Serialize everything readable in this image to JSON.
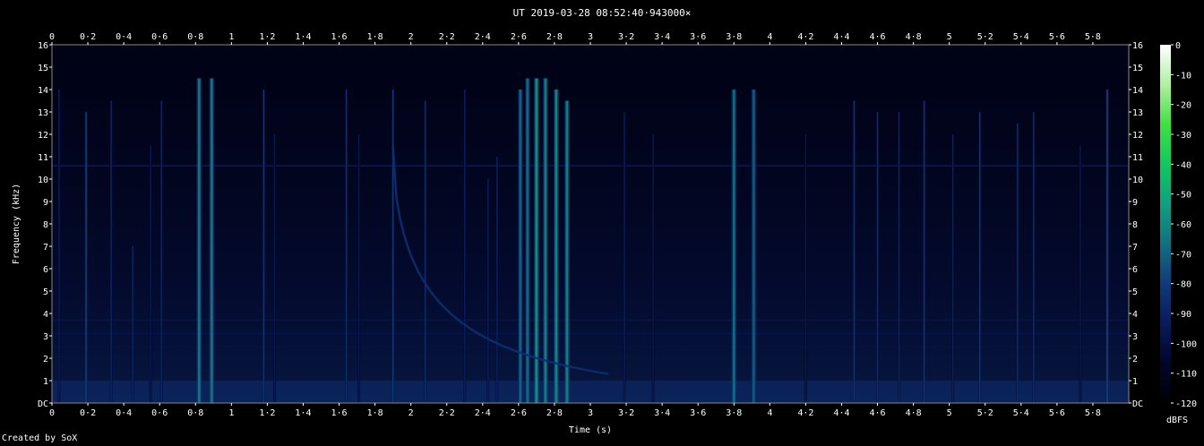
{
  "title": "UT 2019-03-28 08:52:40·943000×",
  "credit": "Created by SoX",
  "chart_data": {
    "type": "heatmap",
    "title": "UT 2019-03-28 08:52:40·943000×",
    "xlabel": "Time (s)",
    "ylabel": "Frequency (kHz)",
    "xlim": [
      0,
      6.0
    ],
    "ylim": [
      0,
      16
    ],
    "x_ticks": [
      "0",
      "0·2",
      "0·4",
      "0·6",
      "0·8",
      "1",
      "1·2",
      "1·4",
      "1·6",
      "1·8",
      "2",
      "2·2",
      "2·4",
      "2·6",
      "2·8",
      "3",
      "3·2",
      "3·4",
      "3·6",
      "3·8",
      "4",
      "4·2",
      "4·4",
      "4·6",
      "4·8",
      "5",
      "5·2",
      "5·4",
      "5·6",
      "5·8"
    ],
    "x_tick_values": [
      0,
      0.2,
      0.4,
      0.6,
      0.8,
      1.0,
      1.2,
      1.4,
      1.6,
      1.8,
      2.0,
      2.2,
      2.4,
      2.6,
      2.8,
      3.0,
      3.2,
      3.4,
      3.6,
      3.8,
      4.0,
      4.2,
      4.4,
      4.6,
      4.8,
      5.0,
      5.2,
      5.4,
      5.6,
      5.8
    ],
    "y_ticks": [
      "DC",
      "1",
      "2",
      "3",
      "4",
      "5",
      "6",
      "7",
      "8",
      "9",
      "10",
      "11",
      "12",
      "13",
      "14",
      "15",
      "16"
    ],
    "y_tick_values": [
      0,
      1,
      2,
      3,
      4,
      5,
      6,
      7,
      8,
      9,
      10,
      11,
      12,
      13,
      14,
      15,
      16
    ],
    "colorbar": {
      "label": "dBFS",
      "ticks": [
        "0",
        "-10",
        "-20",
        "-30",
        "-40",
        "-50",
        "-60",
        "-70",
        "-80",
        "-90",
        "-100",
        "-110",
        "-120"
      ],
      "tick_values": [
        0,
        -10,
        -20,
        -30,
        -40,
        -50,
        -60,
        -70,
        -80,
        -90,
        -100,
        -110,
        -120
      ],
      "range": [
        -120,
        0
      ],
      "colors": [
        "#000005",
        "#00062a",
        "#0a1a5a",
        "#103a7a",
        "#127080",
        "#10a080",
        "#10c860",
        "#40e040",
        "#b0f0a0",
        "#ffffff"
      ]
    },
    "background_level_db": -108,
    "low_band": {
      "fmax_khz": 1.0,
      "level_db": -85
    },
    "hum_lines": [
      {
        "freq_khz": 10.6,
        "level_db": -92
      },
      {
        "freq_khz": 3.7,
        "level_db": -96
      },
      {
        "freq_khz": 3.1,
        "level_db": -96
      },
      {
        "freq_khz": 2.5,
        "level_db": -98
      }
    ],
    "chirp": {
      "t_start": 1.9,
      "t_end": 3.1,
      "f_start_khz": 11.5,
      "f_end_khz": 1.3,
      "level_db": -85
    },
    "clicks": [
      {
        "t": 0.04,
        "fmax_khz": 14.0,
        "level_db": -92
      },
      {
        "t": 0.19,
        "fmax_khz": 13.0,
        "level_db": -78
      },
      {
        "t": 0.33,
        "fmax_khz": 13.5,
        "level_db": -88
      },
      {
        "t": 0.45,
        "fmax_khz": 7.0,
        "level_db": -88
      },
      {
        "t": 0.55,
        "fmax_khz": 11.5,
        "level_db": -95
      },
      {
        "t": 0.61,
        "fmax_khz": 13.5,
        "level_db": -88
      },
      {
        "t": 0.82,
        "fmax_khz": 14.5,
        "level_db": -65
      },
      {
        "t": 0.89,
        "fmax_khz": 14.5,
        "level_db": -65
      },
      {
        "t": 1.18,
        "fmax_khz": 14.0,
        "level_db": -82
      },
      {
        "t": 1.24,
        "fmax_khz": 12.0,
        "level_db": -95
      },
      {
        "t": 1.64,
        "fmax_khz": 14.0,
        "level_db": -85
      },
      {
        "t": 1.71,
        "fmax_khz": 12.0,
        "level_db": -95
      },
      {
        "t": 1.9,
        "fmax_khz": 14.0,
        "level_db": -80
      },
      {
        "t": 2.08,
        "fmax_khz": 13.5,
        "level_db": -85
      },
      {
        "t": 2.3,
        "fmax_khz": 14.0,
        "level_db": -92
      },
      {
        "t": 2.43,
        "fmax_khz": 10.0,
        "level_db": -92
      },
      {
        "t": 2.48,
        "fmax_khz": 11.0,
        "level_db": -90
      },
      {
        "t": 2.61,
        "fmax_khz": 14.0,
        "level_db": -70
      },
      {
        "t": 2.65,
        "fmax_khz": 14.5,
        "level_db": -68
      },
      {
        "t": 2.7,
        "fmax_khz": 14.5,
        "level_db": -58
      },
      {
        "t": 2.75,
        "fmax_khz": 14.5,
        "level_db": -62
      },
      {
        "t": 2.81,
        "fmax_khz": 14.0,
        "level_db": -60
      },
      {
        "t": 2.87,
        "fmax_khz": 13.5,
        "level_db": -62
      },
      {
        "t": 3.19,
        "fmax_khz": 13.0,
        "level_db": -92
      },
      {
        "t": 3.35,
        "fmax_khz": 12.0,
        "level_db": -95
      },
      {
        "t": 3.8,
        "fmax_khz": 14.0,
        "level_db": -68
      },
      {
        "t": 3.91,
        "fmax_khz": 14.0,
        "level_db": -72
      },
      {
        "t": 4.2,
        "fmax_khz": 12.0,
        "level_db": -95
      },
      {
        "t": 4.47,
        "fmax_khz": 13.5,
        "level_db": -82
      },
      {
        "t": 4.6,
        "fmax_khz": 13.0,
        "level_db": -85
      },
      {
        "t": 4.72,
        "fmax_khz": 13.0,
        "level_db": -88
      },
      {
        "t": 4.86,
        "fmax_khz": 13.5,
        "level_db": -82
      },
      {
        "t": 5.02,
        "fmax_khz": 12.0,
        "level_db": -90
      },
      {
        "t": 5.17,
        "fmax_khz": 13.0,
        "level_db": -82
      },
      {
        "t": 5.38,
        "fmax_khz": 12.5,
        "level_db": -85
      },
      {
        "t": 5.47,
        "fmax_khz": 13.0,
        "level_db": -85
      },
      {
        "t": 5.73,
        "fmax_khz": 11.5,
        "level_db": -95
      },
      {
        "t": 5.88,
        "fmax_khz": 14.0,
        "level_db": -76
      }
    ]
  }
}
